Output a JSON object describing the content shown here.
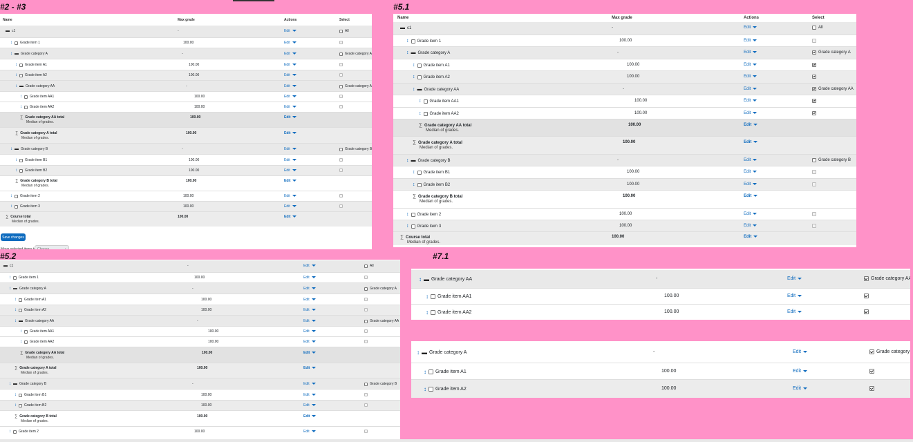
{
  "labels": {
    "p1": "#2 - #3",
    "p2": "#5.1",
    "p3": "#5.2",
    "p4": "#7.1"
  },
  "headers": {
    "name": "Name",
    "max_grade": "Max grade",
    "actions": "Actions",
    "select": "Select"
  },
  "common": {
    "edit": "Edit",
    "all": "All",
    "median": "Median of grades.",
    "dash": "-"
  },
  "panel1_rows": [
    {
      "name": "c1",
      "grade": "-",
      "sel": "All"
    },
    {
      "name": "Grade item 1",
      "grade": "100.00",
      "sel": ""
    },
    {
      "name": "Grade category A",
      "grade": "-",
      "sel": "Grade category A"
    },
    {
      "name": "Grade item A1",
      "grade": "100.00",
      "sel": ""
    },
    {
      "name": "Grade item A2",
      "grade": "100.00",
      "sel": ""
    },
    {
      "name": "Grade category AA",
      "grade": "-",
      "sel": "Grade category AA"
    },
    {
      "name": "Grade item AA1",
      "grade": "100.00",
      "sel": ""
    },
    {
      "name": "Grade item AA2",
      "grade": "100.00",
      "sel": ""
    },
    {
      "name": "Grade category AA total",
      "grade": "100.00",
      "sel": "",
      "sub": "Median of grades."
    },
    {
      "name": "Grade category A total",
      "grade": "100.00",
      "sel": "",
      "sub": "Median of grades."
    },
    {
      "name": "Grade category B",
      "grade": "-",
      "sel": "Grade category B"
    },
    {
      "name": "Grade item B1",
      "grade": "100.00",
      "sel": ""
    },
    {
      "name": "Grade item B2",
      "grade": "100.00",
      "sel": ""
    },
    {
      "name": "Grade category B total",
      "grade": "100.00",
      "sel": "",
      "sub": "Median of grades."
    },
    {
      "name": "Grade item 2",
      "grade": "100.00",
      "sel": ""
    },
    {
      "name": "Grade item 3",
      "grade": "100.00",
      "sel": ""
    },
    {
      "name": "Course total",
      "grade": "100.00",
      "sel": "",
      "sub": "Median of grades."
    }
  ],
  "panel1_footer": {
    "save_label": "Save changes",
    "move_label": "Move selected items to",
    "choose_placeholder": "Choose..."
  },
  "panel2_rows": [
    {
      "name": "c1",
      "grade": "-",
      "sel": "All"
    },
    {
      "name": "Grade item 1",
      "grade": "100.00",
      "sel": ""
    },
    {
      "name": "Grade category A",
      "grade": "-",
      "sel": "Grade category A"
    },
    {
      "name": "Grade item A1",
      "grade": "100.00",
      "sel": ""
    },
    {
      "name": "Grade item A2",
      "grade": "100.00",
      "sel": ""
    },
    {
      "name": "Grade category AA",
      "grade": "-",
      "sel": "Grade category AA"
    },
    {
      "name": "Grade item AA1",
      "grade": "100.00",
      "sel": ""
    },
    {
      "name": "Grade item AA2",
      "grade": "100.00",
      "sel": ""
    },
    {
      "name": "Grade category AA total",
      "grade": "100.00",
      "sel": "",
      "sub": "Median of grades."
    },
    {
      "name": "Grade category A total",
      "grade": "100.00",
      "sel": "",
      "sub": "Median of grades."
    },
    {
      "name": "Grade category B",
      "grade": "-",
      "sel": "Grade category B"
    },
    {
      "name": "Grade item B1",
      "grade": "100.00",
      "sel": ""
    },
    {
      "name": "Grade item B2",
      "grade": "100.00",
      "sel": ""
    },
    {
      "name": "Grade category B total",
      "grade": "100.00",
      "sel": "",
      "sub": "Median of grades."
    },
    {
      "name": "Grade item 2",
      "grade": "100.00",
      "sel": ""
    },
    {
      "name": "Grade item 3",
      "grade": "100.00",
      "sel": ""
    },
    {
      "name": "Course total",
      "grade": "100.00",
      "sel": "",
      "sub": "Median of grades."
    }
  ],
  "panel3_rows": [
    {
      "name": "c1",
      "grade": "-",
      "sel": "All"
    },
    {
      "name": "Grade item 1",
      "grade": "100.00",
      "sel": ""
    },
    {
      "name": "Grade category A",
      "grade": "-",
      "sel": "Grade category A"
    },
    {
      "name": "Grade item A1",
      "grade": "100.00",
      "sel": ""
    },
    {
      "name": "Grade item A2",
      "grade": "100.00",
      "sel": ""
    },
    {
      "name": "Grade category AA",
      "grade": "-",
      "sel": "Grade category AA"
    },
    {
      "name": "Grade item AA1",
      "grade": "100.00",
      "sel": ""
    },
    {
      "name": "Grade item AA2",
      "grade": "100.00",
      "sel": ""
    },
    {
      "name": "Grade category AA total",
      "grade": "100.00",
      "sel": "",
      "sub": "Median of grades."
    },
    {
      "name": "Grade category A total",
      "grade": "100.00",
      "sel": "",
      "sub": "Median of grades."
    },
    {
      "name": "Grade category B",
      "grade": "-",
      "sel": "Grade category B"
    },
    {
      "name": "Grade item B1",
      "grade": "100.00",
      "sel": ""
    },
    {
      "name": "Grade item B2",
      "grade": "100.00",
      "sel": ""
    },
    {
      "name": "Grade category B total",
      "grade": "100.00",
      "sel": "",
      "sub": "Median of grades."
    },
    {
      "name": "Grade item 2",
      "grade": "100.00",
      "sel": ""
    }
  ],
  "panel4_rows": [
    {
      "name": "Grade category AA",
      "grade": "-",
      "sel": "Grade category AA"
    },
    {
      "name": "Grade item AA1",
      "grade": "100.00",
      "sel": ""
    },
    {
      "name": "Grade item AA2",
      "grade": "100.00",
      "sel": ""
    }
  ],
  "panel5_rows": [
    {
      "name": "Grade category A",
      "grade": "-",
      "sel": "Grade category A"
    },
    {
      "name": "Grade item A1",
      "grade": "100.00",
      "sel": ""
    },
    {
      "name": "Grade item A2",
      "grade": "100.00",
      "sel": ""
    }
  ]
}
